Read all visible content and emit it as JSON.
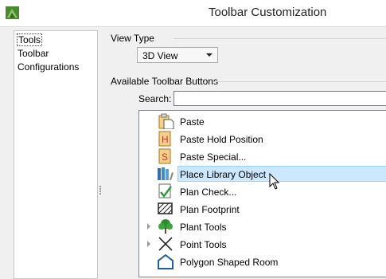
{
  "window": {
    "title": "Toolbar Customization",
    "app_icon": "chief-architect-app-icon"
  },
  "sidebar": {
    "items": [
      {
        "label": "Tools",
        "selected": true
      },
      {
        "label": "Toolbar"
      },
      {
        "label": "Configurations"
      }
    ]
  },
  "view_type": {
    "group_label": "View Type",
    "selected": "3D View"
  },
  "available": {
    "group_label": "Available Toolbar Buttons",
    "search_label": "Search:",
    "search_value": "",
    "items": [
      {
        "label": "Paste",
        "icon": "paste-icon"
      },
      {
        "label": "Paste Hold Position",
        "icon": "paste-hold-position-icon"
      },
      {
        "label": "Paste Special...",
        "icon": "paste-special-icon"
      },
      {
        "label": "Place Library Object",
        "icon": "place-library-object-icon",
        "selected": true
      },
      {
        "label": "Plan Check...",
        "icon": "plan-check-icon"
      },
      {
        "label": "Plan Footprint",
        "icon": "plan-footprint-icon"
      },
      {
        "label": "Plant Tools",
        "icon": "plant-tools-icon",
        "expandable": true
      },
      {
        "label": "Point Tools",
        "icon": "point-tools-icon",
        "expandable": true
      },
      {
        "label": "Polygon Shaped Room",
        "icon": "polygon-shaped-room-icon"
      }
    ]
  }
}
